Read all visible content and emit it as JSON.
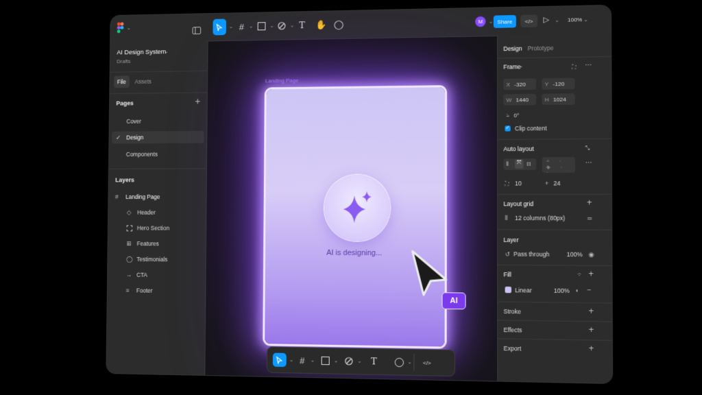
{
  "app": {
    "file_name": "AI Design System",
    "location": "Drafts"
  },
  "left_tabs": {
    "file": "File",
    "assets": "Assets"
  },
  "pages": {
    "title": "Pages",
    "items": [
      {
        "label": "Cover",
        "selected": false
      },
      {
        "label": "Design",
        "selected": true
      },
      {
        "label": "Components",
        "selected": false
      }
    ]
  },
  "layers": {
    "title": "Layers",
    "root": {
      "label": "Landing Page",
      "icon": "frame-icon"
    },
    "items": [
      {
        "label": "Header",
        "icon": "component-icon"
      },
      {
        "label": "Hero Section",
        "icon": "section-icon"
      },
      {
        "label": "Features",
        "icon": "grid-icon"
      },
      {
        "label": "Testimonials",
        "icon": "comment-icon"
      },
      {
        "label": "CTA",
        "icon": "arrow-icon"
      },
      {
        "label": "Footer",
        "icon": "lines-icon"
      }
    ]
  },
  "topbar": {
    "avatar_initial": "M",
    "share_label": "Share",
    "zoom": "100%"
  },
  "canvas": {
    "frame_label": "Landing Page",
    "status_text": "AI is designing...",
    "cursor_badge": "AI"
  },
  "right_tabs": {
    "design": "Design",
    "prototype": "Prototype"
  },
  "frame_props": {
    "title": "Frame",
    "x_label": "X",
    "x": "-320",
    "y_label": "Y",
    "y": "-120",
    "w_label": "W",
    "w": "1440",
    "h_label": "H",
    "h": "1024",
    "rotation": "0°",
    "clip_content": "Clip content"
  },
  "auto_layout": {
    "title": "Auto layout",
    "gap": "10",
    "padding": "24"
  },
  "layout_grid": {
    "title": "Layout grid",
    "value": "12 columns (80px)"
  },
  "layer_props": {
    "title": "Layer",
    "blend": "Pass through",
    "opacity": "100%"
  },
  "fill": {
    "title": "Fill",
    "type": "Linear",
    "opacity": "100%",
    "swatch_color": "#c9c2f2"
  },
  "stroke": {
    "title": "Stroke"
  },
  "effects": {
    "title": "Effects"
  },
  "export": {
    "title": "Export"
  },
  "colors": {
    "accent": "#0d99ff",
    "avatar": "#8a4dff",
    "ai_purple": "#7c3aed"
  }
}
